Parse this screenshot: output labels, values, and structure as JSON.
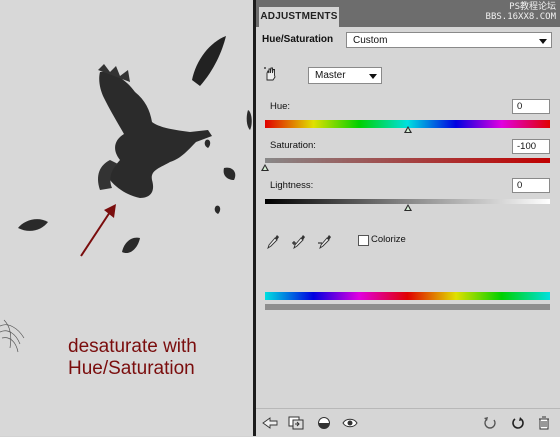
{
  "caption": {
    "line1": "desaturate with",
    "line2": "Hue/Saturation"
  },
  "panel": {
    "tab_label": "ADJUSTMENTS",
    "watermark_line1": "PS教程论坛",
    "watermark_line2": "BBS.16XX8.COM",
    "title": "Hue/Saturation",
    "preset_value": "Custom",
    "channel_value": "Master",
    "hue": {
      "label": "Hue:",
      "value": "0",
      "level": 0.5
    },
    "saturation": {
      "label": "Saturation:",
      "value": "-100",
      "level": 0.0
    },
    "lightness": {
      "label": "Lightness:",
      "value": "0",
      "level": 0.5
    },
    "colorize_label": "Colorize",
    "colorize_checked": false
  },
  "icons": [
    "hand-icon",
    "eyedropper-icon",
    "eyedropper-plus-icon",
    "eyedropper-minus-icon",
    "back-arrow-icon",
    "clip-layer-icon",
    "visibility-circle-icon",
    "eye-icon",
    "reset-icon",
    "refresh-icon",
    "trash-icon"
  ],
  "colors": {
    "caption": "#7a0d0d",
    "arrow": "#7a0d0d",
    "tabbar": "#6d6d6d"
  }
}
